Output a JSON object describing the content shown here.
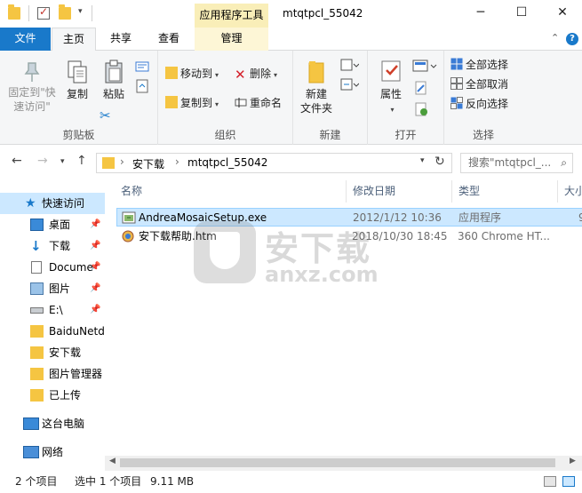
{
  "title_bar": {
    "window_title": "mtqtpcl_55042",
    "context_tab": "应用程序工具",
    "minimize_icon": "minimize-icon",
    "maximize_icon": "maximize-icon",
    "close_icon": "close-icon"
  },
  "tabs": {
    "file": "文件",
    "home": "主页",
    "share": "共享",
    "view": "查看",
    "manage": "管理"
  },
  "ribbon": {
    "clipboard": {
      "label": "剪贴板",
      "pin_quick": "固定到\"快\n速访问\"",
      "copy": "复制",
      "paste": "粘贴"
    },
    "organize": {
      "label": "组织",
      "move_to": "移动到",
      "copy_to": "复制到",
      "delete": "删除",
      "rename": "重命名"
    },
    "new": {
      "label": "新建",
      "new_folder": "新建\n文件夹"
    },
    "open": {
      "label": "打开",
      "properties": "属性"
    },
    "select": {
      "label": "选择",
      "select_all": "全部选择",
      "select_none": "全部取消",
      "invert": "反向选择"
    }
  },
  "address": {
    "crumb_root": "安下载",
    "crumb_folder": "mtqtpcl_55042",
    "search_placeholder": "搜索\"mtqtpcl_...",
    "separator": "›"
  },
  "nav": {
    "quick_access": "快速访问",
    "desktop": "桌面",
    "downloads": "下载",
    "documents": "Docume",
    "pictures": "图片",
    "drive_e": "E:\\",
    "baidunetdisk": "BaiduNetd",
    "anxz": "安下载",
    "pic_manager": "图片管理器",
    "uploaded": "已上传",
    "this_pc": "这台电脑",
    "network": "网络"
  },
  "columns": {
    "name": "名称",
    "date": "修改日期",
    "type": "类型",
    "size": "大小"
  },
  "files": [
    {
      "name": "AndreaMosaicSetup.exe",
      "date": "2012/1/12 10:36",
      "type": "应用程序",
      "size": "9"
    },
    {
      "name": "安下载帮助.htm",
      "date": "2018/10/30 18:45",
      "type": "360 Chrome HT...",
      "size": ""
    }
  ],
  "watermark": {
    "text": "安下载",
    "sub": "anxz.com"
  },
  "status": {
    "items_count": "2 个项目",
    "selected": "选中 1 个项目",
    "selected_size": "9.11 MB"
  },
  "colors": {
    "accent": "#1979ca",
    "selection": "#cce8ff",
    "context_tab": "#f9eeb8"
  }
}
